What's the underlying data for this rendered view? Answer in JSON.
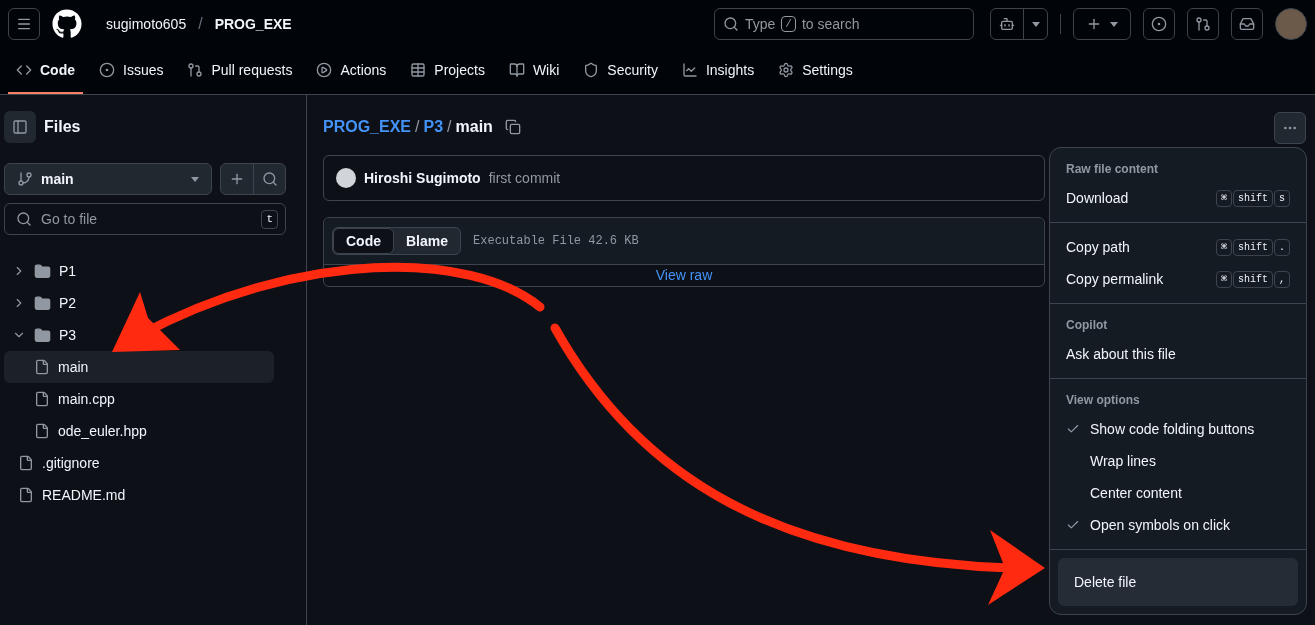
{
  "header": {
    "owner": "sugimoto605",
    "separator": "/",
    "repo": "PROG_EXE",
    "search": {
      "before": "Type",
      "key": "/",
      "after": "to search"
    }
  },
  "nav": [
    {
      "label": "Code",
      "selected": true
    },
    {
      "label": "Issues",
      "selected": false
    },
    {
      "label": "Pull requests",
      "selected": false
    },
    {
      "label": "Actions",
      "selected": false
    },
    {
      "label": "Projects",
      "selected": false
    },
    {
      "label": "Wiki",
      "selected": false
    },
    {
      "label": "Security",
      "selected": false
    },
    {
      "label": "Insights",
      "selected": false
    },
    {
      "label": "Settings",
      "selected": false
    }
  ],
  "sidebar": {
    "title": "Files",
    "branch": "main",
    "goto": {
      "placeholder": "Go to file",
      "shortcut": "t"
    },
    "tree": [
      {
        "name": "P1",
        "kind": "folder",
        "expanded": false
      },
      {
        "name": "P2",
        "kind": "folder",
        "expanded": false
      },
      {
        "name": "P3",
        "kind": "folder",
        "expanded": true,
        "children": [
          {
            "name": "main",
            "kind": "file",
            "selected": true
          },
          {
            "name": "main.cpp",
            "kind": "file",
            "selected": false
          },
          {
            "name": "ode_euler.hpp",
            "kind": "file",
            "selected": false
          }
        ]
      },
      {
        "name": ".gitignore",
        "kind": "file",
        "selected": false
      },
      {
        "name": "README.md",
        "kind": "file",
        "selected": false
      }
    ]
  },
  "main": {
    "breadcrumb": [
      {
        "label": "PROG_EXE",
        "kind": "link"
      },
      {
        "label": "P3",
        "kind": "link"
      },
      {
        "label": "main",
        "kind": "current"
      }
    ],
    "breadcrumb_separator": "/",
    "commit": {
      "author": "Hiroshi Sugimoto",
      "message": "first commit"
    },
    "file_view": {
      "tabs": [
        {
          "label": "Code",
          "selected": true
        },
        {
          "label": "Blame",
          "selected": false
        }
      ],
      "info": "Executable File 42.6 KB",
      "view_raw": "View raw"
    }
  },
  "menu": {
    "sections": [
      {
        "title": "Raw file content",
        "items": [
          {
            "label": "Download",
            "keys": [
              "⌘",
              "shift",
              "s"
            ]
          }
        ]
      },
      {
        "items": [
          {
            "label": "Copy path",
            "keys": [
              "⌘",
              "shift",
              "."
            ]
          },
          {
            "label": "Copy permalink",
            "keys": [
              "⌘",
              "shift",
              ","
            ]
          }
        ]
      },
      {
        "title": "Copilot",
        "items": [
          {
            "label": "Ask about this file"
          }
        ]
      },
      {
        "title": "View options",
        "items": [
          {
            "label": "Show code folding buttons",
            "checked": true
          },
          {
            "label": "Wrap lines",
            "checked": false
          },
          {
            "label": "Center content",
            "checked": false
          },
          {
            "label": "Open symbols on click",
            "checked": true
          }
        ]
      },
      {
        "items": [
          {
            "label": "Delete file",
            "selected": true
          }
        ]
      }
    ]
  }
}
